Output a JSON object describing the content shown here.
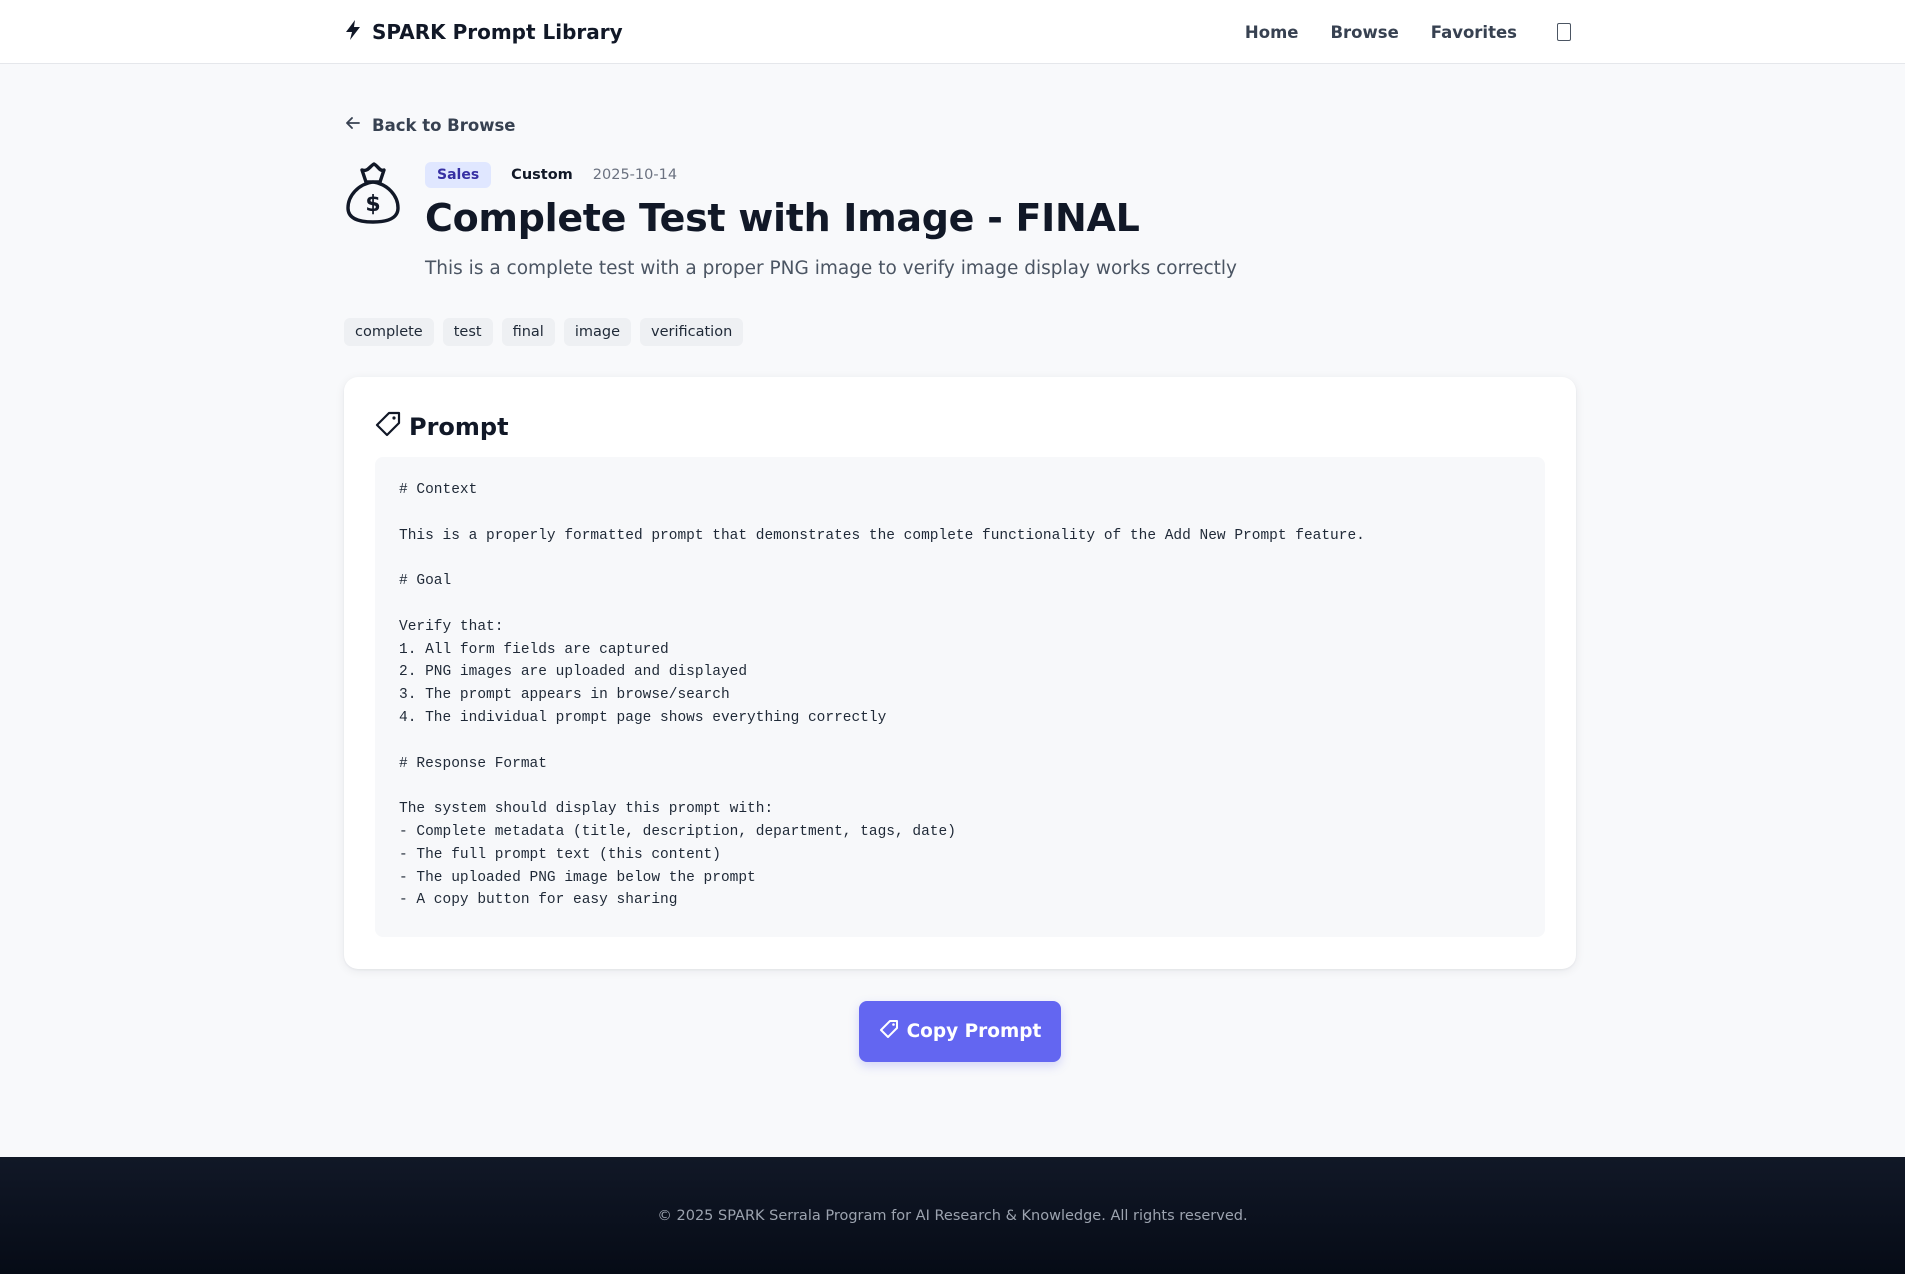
{
  "header": {
    "brand": "SPARK Prompt Library",
    "nav": [
      "Home",
      "Browse",
      "Favorites"
    ]
  },
  "back_label": "Back to Browse",
  "prompt": {
    "department": "Sales",
    "type": "Custom",
    "date": "2025-10-14",
    "title": "Complete Test with Image - FINAL",
    "description": "This is a complete test with a proper PNG image to verify image display works correctly",
    "tags": [
      "complete",
      "test",
      "final",
      "image",
      "verification"
    ],
    "section_title": "Prompt",
    "lines": [
      "# Context",
      "",
      "This is a properly formatted prompt that demonstrates the complete functionality of the Add New Prompt feature.",
      "",
      "# Goal",
      "",
      "Verify that:",
      "1. All form fields are captured",
      "2. PNG images are uploaded and displayed",
      "3. The prompt appears in browse/search",
      "4. The individual prompt page shows everything correctly",
      "",
      "# Response Format",
      "",
      "The system should display this prompt with:",
      "- Complete metadata (title, description, department, tags, date)",
      "- The full prompt text (this content)",
      "- The uploaded PNG image below the prompt",
      "- A copy button for easy sharing"
    ]
  },
  "copy_label": "Copy Prompt",
  "footer": "© 2025 SPARK Serrala Program for AI Research & Knowledge. All rights reserved.",
  "icons": {
    "brand": "lightning-icon",
    "theme": "theme-toggle-icon",
    "back": "arrow-left-icon",
    "hero": "money-bag-icon",
    "prompt": "tag-icon"
  },
  "colors": {
    "accent": "#6366f1",
    "badge_bg": "#e0e7ff",
    "badge_text": "#3730a3",
    "footer_bg": "#111827"
  }
}
